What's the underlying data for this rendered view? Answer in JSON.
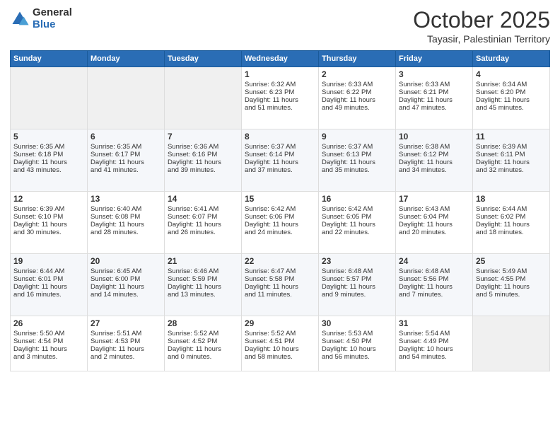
{
  "header": {
    "logo_general": "General",
    "logo_blue": "Blue",
    "month": "October 2025",
    "location": "Tayasir, Palestinian Territory"
  },
  "weekdays": [
    "Sunday",
    "Monday",
    "Tuesday",
    "Wednesday",
    "Thursday",
    "Friday",
    "Saturday"
  ],
  "weeks": [
    [
      {
        "day": "",
        "info": ""
      },
      {
        "day": "",
        "info": ""
      },
      {
        "day": "",
        "info": ""
      },
      {
        "day": "1",
        "info": "Sunrise: 6:32 AM\nSunset: 6:23 PM\nDaylight: 11 hours\nand 51 minutes."
      },
      {
        "day": "2",
        "info": "Sunrise: 6:33 AM\nSunset: 6:22 PM\nDaylight: 11 hours\nand 49 minutes."
      },
      {
        "day": "3",
        "info": "Sunrise: 6:33 AM\nSunset: 6:21 PM\nDaylight: 11 hours\nand 47 minutes."
      },
      {
        "day": "4",
        "info": "Sunrise: 6:34 AM\nSunset: 6:20 PM\nDaylight: 11 hours\nand 45 minutes."
      }
    ],
    [
      {
        "day": "5",
        "info": "Sunrise: 6:35 AM\nSunset: 6:18 PM\nDaylight: 11 hours\nand 43 minutes."
      },
      {
        "day": "6",
        "info": "Sunrise: 6:35 AM\nSunset: 6:17 PM\nDaylight: 11 hours\nand 41 minutes."
      },
      {
        "day": "7",
        "info": "Sunrise: 6:36 AM\nSunset: 6:16 PM\nDaylight: 11 hours\nand 39 minutes."
      },
      {
        "day": "8",
        "info": "Sunrise: 6:37 AM\nSunset: 6:14 PM\nDaylight: 11 hours\nand 37 minutes."
      },
      {
        "day": "9",
        "info": "Sunrise: 6:37 AM\nSunset: 6:13 PM\nDaylight: 11 hours\nand 35 minutes."
      },
      {
        "day": "10",
        "info": "Sunrise: 6:38 AM\nSunset: 6:12 PM\nDaylight: 11 hours\nand 34 minutes."
      },
      {
        "day": "11",
        "info": "Sunrise: 6:39 AM\nSunset: 6:11 PM\nDaylight: 11 hours\nand 32 minutes."
      }
    ],
    [
      {
        "day": "12",
        "info": "Sunrise: 6:39 AM\nSunset: 6:10 PM\nDaylight: 11 hours\nand 30 minutes."
      },
      {
        "day": "13",
        "info": "Sunrise: 6:40 AM\nSunset: 6:08 PM\nDaylight: 11 hours\nand 28 minutes."
      },
      {
        "day": "14",
        "info": "Sunrise: 6:41 AM\nSunset: 6:07 PM\nDaylight: 11 hours\nand 26 minutes."
      },
      {
        "day": "15",
        "info": "Sunrise: 6:42 AM\nSunset: 6:06 PM\nDaylight: 11 hours\nand 24 minutes."
      },
      {
        "day": "16",
        "info": "Sunrise: 6:42 AM\nSunset: 6:05 PM\nDaylight: 11 hours\nand 22 minutes."
      },
      {
        "day": "17",
        "info": "Sunrise: 6:43 AM\nSunset: 6:04 PM\nDaylight: 11 hours\nand 20 minutes."
      },
      {
        "day": "18",
        "info": "Sunrise: 6:44 AM\nSunset: 6:02 PM\nDaylight: 11 hours\nand 18 minutes."
      }
    ],
    [
      {
        "day": "19",
        "info": "Sunrise: 6:44 AM\nSunset: 6:01 PM\nDaylight: 11 hours\nand 16 minutes."
      },
      {
        "day": "20",
        "info": "Sunrise: 6:45 AM\nSunset: 6:00 PM\nDaylight: 11 hours\nand 14 minutes."
      },
      {
        "day": "21",
        "info": "Sunrise: 6:46 AM\nSunset: 5:59 PM\nDaylight: 11 hours\nand 13 minutes."
      },
      {
        "day": "22",
        "info": "Sunrise: 6:47 AM\nSunset: 5:58 PM\nDaylight: 11 hours\nand 11 minutes."
      },
      {
        "day": "23",
        "info": "Sunrise: 6:48 AM\nSunset: 5:57 PM\nDaylight: 11 hours\nand 9 minutes."
      },
      {
        "day": "24",
        "info": "Sunrise: 6:48 AM\nSunset: 5:56 PM\nDaylight: 11 hours\nand 7 minutes."
      },
      {
        "day": "25",
        "info": "Sunrise: 5:49 AM\nSunset: 4:55 PM\nDaylight: 11 hours\nand 5 minutes."
      }
    ],
    [
      {
        "day": "26",
        "info": "Sunrise: 5:50 AM\nSunset: 4:54 PM\nDaylight: 11 hours\nand 3 minutes."
      },
      {
        "day": "27",
        "info": "Sunrise: 5:51 AM\nSunset: 4:53 PM\nDaylight: 11 hours\nand 2 minutes."
      },
      {
        "day": "28",
        "info": "Sunrise: 5:52 AM\nSunset: 4:52 PM\nDaylight: 11 hours\nand 0 minutes."
      },
      {
        "day": "29",
        "info": "Sunrise: 5:52 AM\nSunset: 4:51 PM\nDaylight: 10 hours\nand 58 minutes."
      },
      {
        "day": "30",
        "info": "Sunrise: 5:53 AM\nSunset: 4:50 PM\nDaylight: 10 hours\nand 56 minutes."
      },
      {
        "day": "31",
        "info": "Sunrise: 5:54 AM\nSunset: 4:49 PM\nDaylight: 10 hours\nand 54 minutes."
      },
      {
        "day": "",
        "info": ""
      }
    ]
  ]
}
